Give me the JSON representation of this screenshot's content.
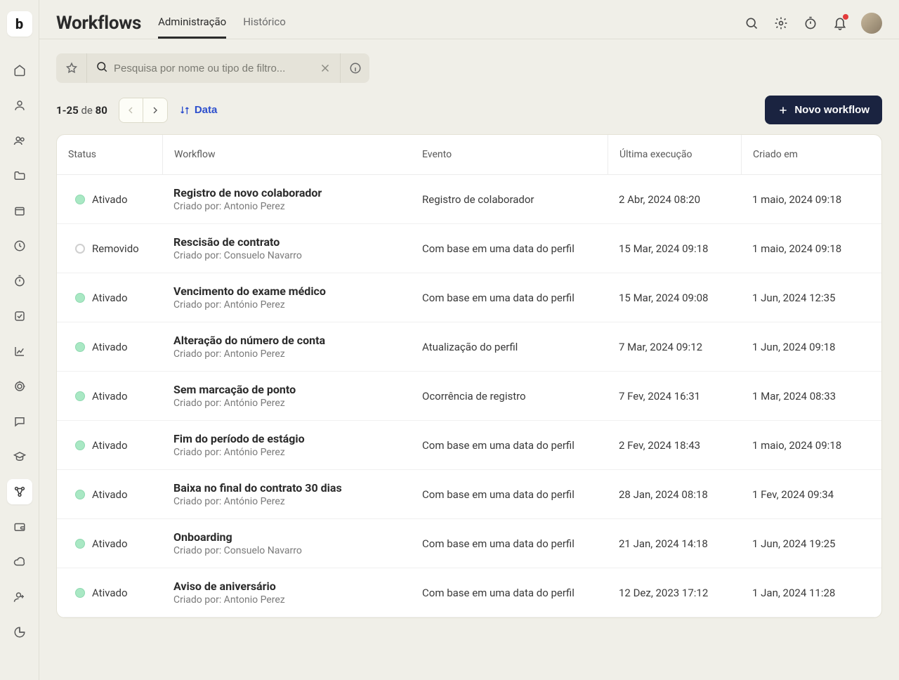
{
  "sidebar": {
    "logo_text": "b",
    "items": [
      {
        "name": "home",
        "icon": "home"
      },
      {
        "name": "user",
        "icon": "user"
      },
      {
        "name": "users",
        "icon": "users"
      },
      {
        "name": "folder",
        "icon": "folder"
      },
      {
        "name": "box",
        "icon": "box"
      },
      {
        "name": "clock",
        "icon": "clock"
      },
      {
        "name": "stopwatch",
        "icon": "stopwatch"
      },
      {
        "name": "check",
        "icon": "check"
      },
      {
        "name": "chart",
        "icon": "chart"
      },
      {
        "name": "target",
        "icon": "target"
      },
      {
        "name": "chat",
        "icon": "chat"
      },
      {
        "name": "graduation",
        "icon": "graduation"
      },
      {
        "name": "workflow",
        "icon": "workflow",
        "active": true
      },
      {
        "name": "wallet",
        "icon": "wallet"
      },
      {
        "name": "cloud",
        "icon": "cloud"
      },
      {
        "name": "adduser",
        "icon": "adduser"
      },
      {
        "name": "pie",
        "icon": "pie"
      }
    ]
  },
  "header": {
    "title": "Workflows",
    "tabs": {
      "admin": "Administração",
      "history": "Histórico"
    },
    "active_tab": "admin"
  },
  "filter": {
    "placeholder": "Pesquisa por nome ou tipo de filtro..."
  },
  "pagination": {
    "range": "1-25",
    "of": "de",
    "total": "80"
  },
  "sort": {
    "label": "Data"
  },
  "new_button": {
    "label": "Novo workflow"
  },
  "columns": {
    "status": "Status",
    "workflow": "Workflow",
    "event": "Evento",
    "last_run": "Última execução",
    "created": "Criado em"
  },
  "status_labels": {
    "active": "Ativado",
    "removed": "Removido"
  },
  "created_by_prefix": "Criado por: ",
  "rows": [
    {
      "status": "active",
      "name": "Registro de novo colaborador",
      "by": "Antonio Perez",
      "event": "Registro de colaborador",
      "last": "2 Abr, 2024 08:20",
      "created": "1 maio, 2024 09:18"
    },
    {
      "status": "removed",
      "name": "Rescisão de contrato",
      "by": "Consuelo Navarro",
      "event": "Com base em uma data do perfil",
      "last": "15 Mar, 2024 09:18",
      "created": "1 maio, 2024 09:18"
    },
    {
      "status": "active",
      "name": "Vencimento do exame médico",
      "by": "António Perez",
      "event": "Com base em uma data do perfil",
      "last": "15 Mar, 2024 09:08",
      "created": "1 Jun, 2024 12:35"
    },
    {
      "status": "active",
      "name": "Alteração do número de conta",
      "by": "Antonio Perez",
      "event": "Atualização do perfil",
      "last": "7 Mar, 2024 09:12",
      "created": "1 Jun, 2024 09:18"
    },
    {
      "status": "active",
      "name": "Sem marcação de ponto",
      "by": "António Perez",
      "event": "Ocorrência de registro",
      "last": "7 Fev, 2024 16:31",
      "created": "1 Mar, 2024 08:33"
    },
    {
      "status": "active",
      "name": "Fim do período de estágio",
      "by": "António Perez",
      "event": "Com base em uma data do perfil",
      "last": "2 Fev, 2024 18:43",
      "created": "1 maio, 2024 09:18"
    },
    {
      "status": "active",
      "name": "Baixa no final do contrato 30 dias",
      "by": "António Perez",
      "event": "Com base em uma data do perfil",
      "last": "28 Jan, 2024 08:18",
      "created": "1 Fev, 2024 09:34"
    },
    {
      "status": "active",
      "name": "Onboarding",
      "by": "Consuelo Navarro",
      "event": "Com base em uma data do perfil",
      "last": "21 Jan, 2024 14:18",
      "created": "1 Jun, 2024 19:25"
    },
    {
      "status": "active",
      "name": "Aviso de aniversário",
      "by": "Antonio Perez",
      "event": "Com base em uma data do perfil",
      "last": "12 Dez, 2023 17:12",
      "created": "1 Jan, 2024 11:28"
    }
  ]
}
